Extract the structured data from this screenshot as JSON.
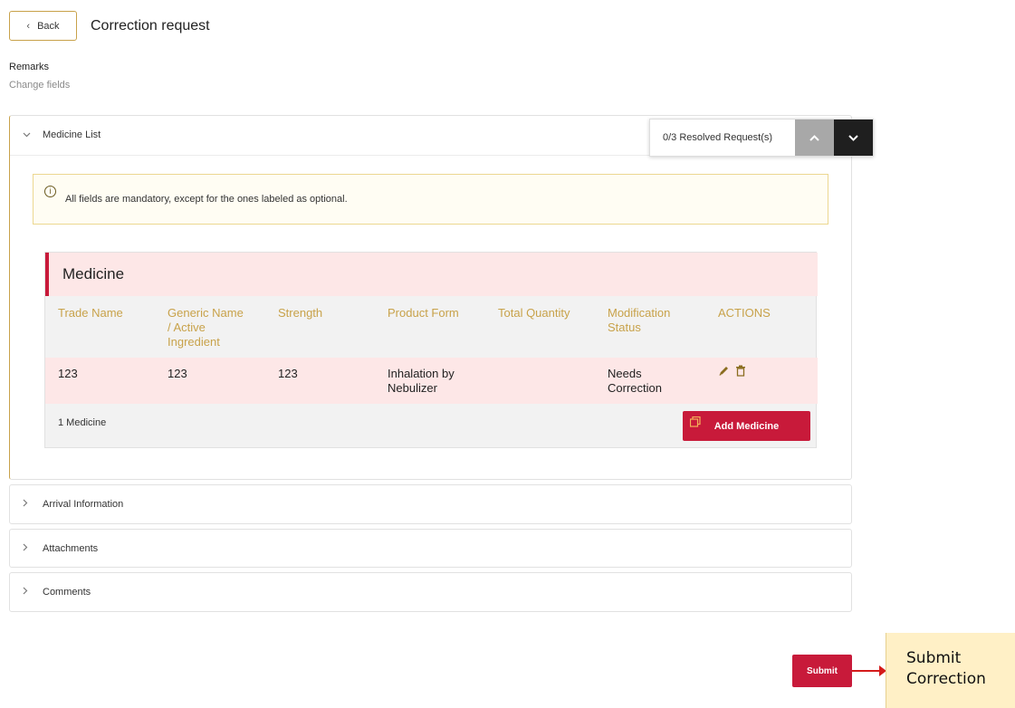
{
  "header": {
    "back_label": "Back",
    "title": "Correction request"
  },
  "remarks": {
    "label": "Remarks",
    "sub": "Change fields"
  },
  "medicine_panel": {
    "title": "Medicine List",
    "resolved_label": "0/3 Resolved Request(s)",
    "alert_text": "All fields are mandatory, except for the ones labeled as optional.",
    "card_title": "Medicine",
    "columns": {
      "trade_name": "Trade Name",
      "generic_line1": "Generic Name",
      "generic_line2": "/ Active",
      "generic_line3": "Ingredient",
      "strength": "Strength",
      "product_form": "Product Form",
      "total_quantity": "Total Quantity",
      "mod_line1": "Modification",
      "mod_line2": "Status",
      "actions": "ACTIONS"
    },
    "rows": [
      {
        "trade_name": "123",
        "generic_name": "123",
        "strength": "123",
        "form_line1": "Inhalation by",
        "form_line2": "Nebulizer",
        "total_quantity": "",
        "status_line1": "Needs",
        "status_line2": "Correction"
      }
    ],
    "count_label": "1 Medicine",
    "add_label": "Add Medicine"
  },
  "sections": {
    "arrival": "Arrival Information",
    "attachments": "Attachments",
    "comments": "Comments"
  },
  "submit_label": "Submit",
  "callout": {
    "line1": "Submit",
    "line2": "Correction"
  },
  "colors": {
    "accent_gold": "#c8a24a",
    "brand_red": "#c81a3a",
    "row_pink": "#fde7e7",
    "callout_bg": "#fff0c6"
  }
}
